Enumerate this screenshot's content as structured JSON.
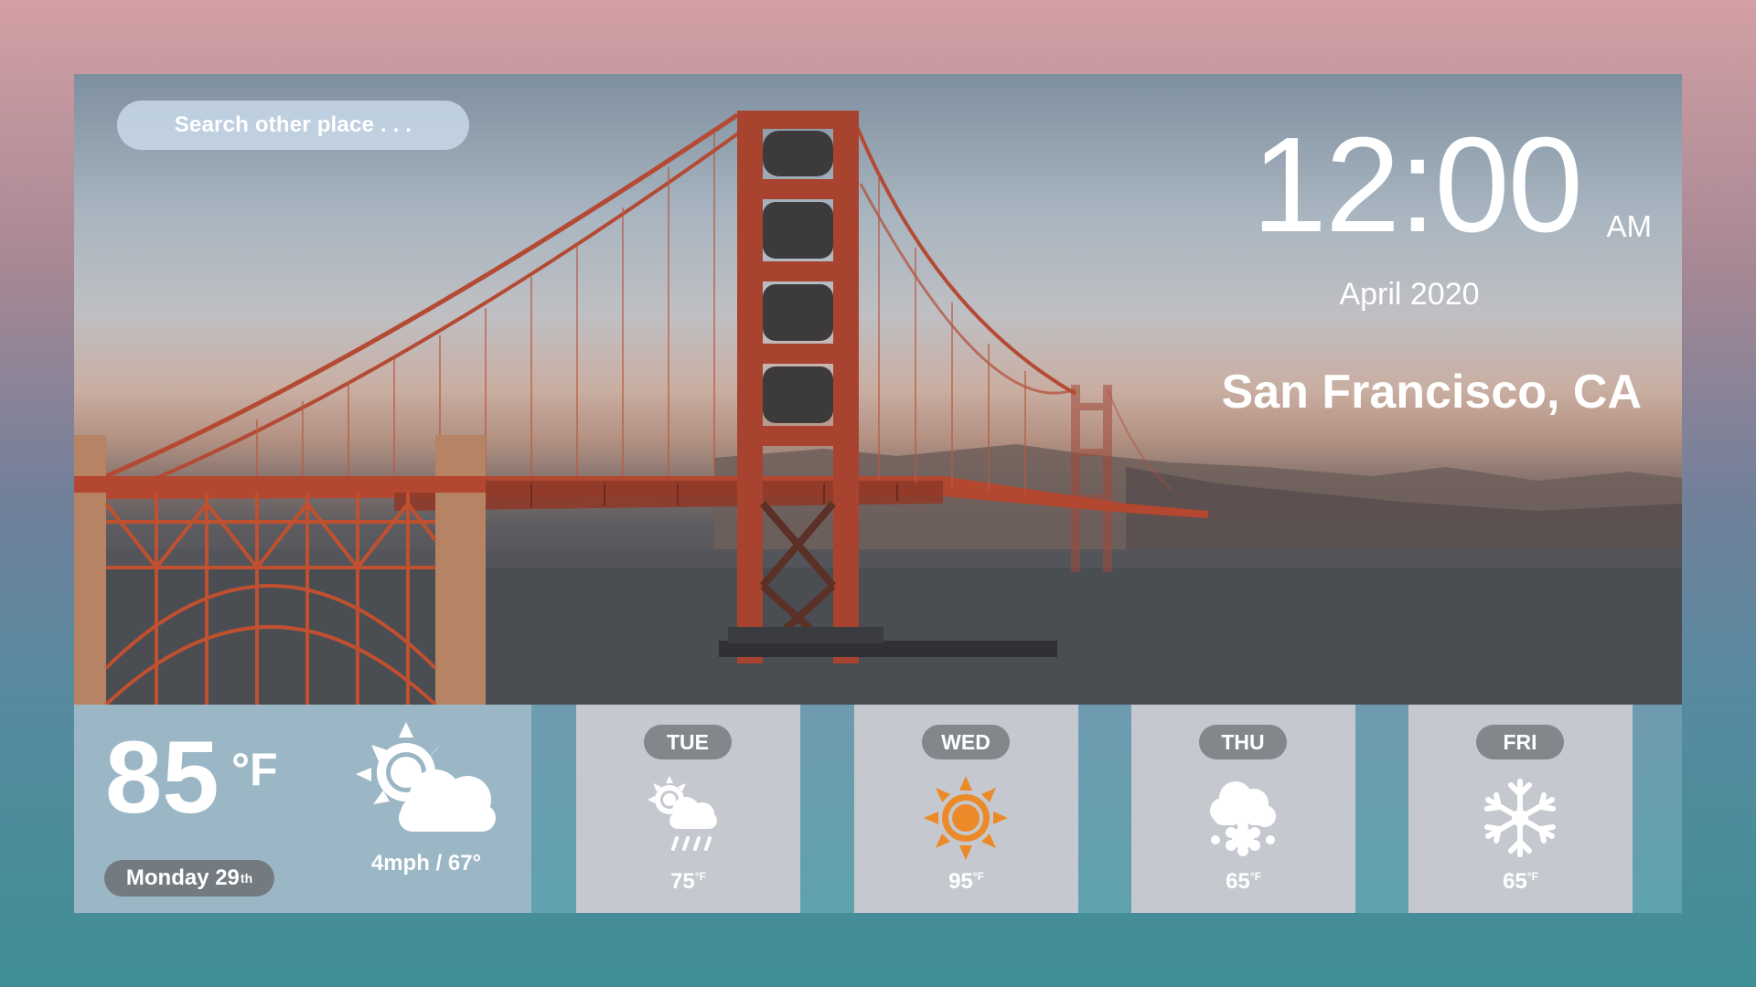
{
  "search": {
    "placeholder_text": "Search other place . . ."
  },
  "clock": {
    "time": "12:00",
    "ampm": "AM",
    "date": "April 2020"
  },
  "location": "San Francisco, CA",
  "current": {
    "temperature": "85",
    "unit": "°F",
    "day_label": "Monday 29",
    "day_suffix": "th",
    "wind": "4mph / 67°",
    "icon": "sun-cloud-icon"
  },
  "forecast": [
    {
      "day": "TUE",
      "temp": "75",
      "unit": "°F",
      "icon": "sun-rain-icon"
    },
    {
      "day": "WED",
      "temp": "95",
      "unit": "°F",
      "icon": "sun-icon"
    },
    {
      "day": "THU",
      "temp": "65",
      "unit": "°F",
      "icon": "snow-cloud-icon"
    },
    {
      "day": "FRI",
      "temp": "65",
      "unit": "°F",
      "icon": "snowflake-icon"
    }
  ],
  "colors": {
    "sun_accent": "#ec8a2a",
    "card_gray": "#c5c9cf",
    "pill_gray": "#82878c"
  }
}
